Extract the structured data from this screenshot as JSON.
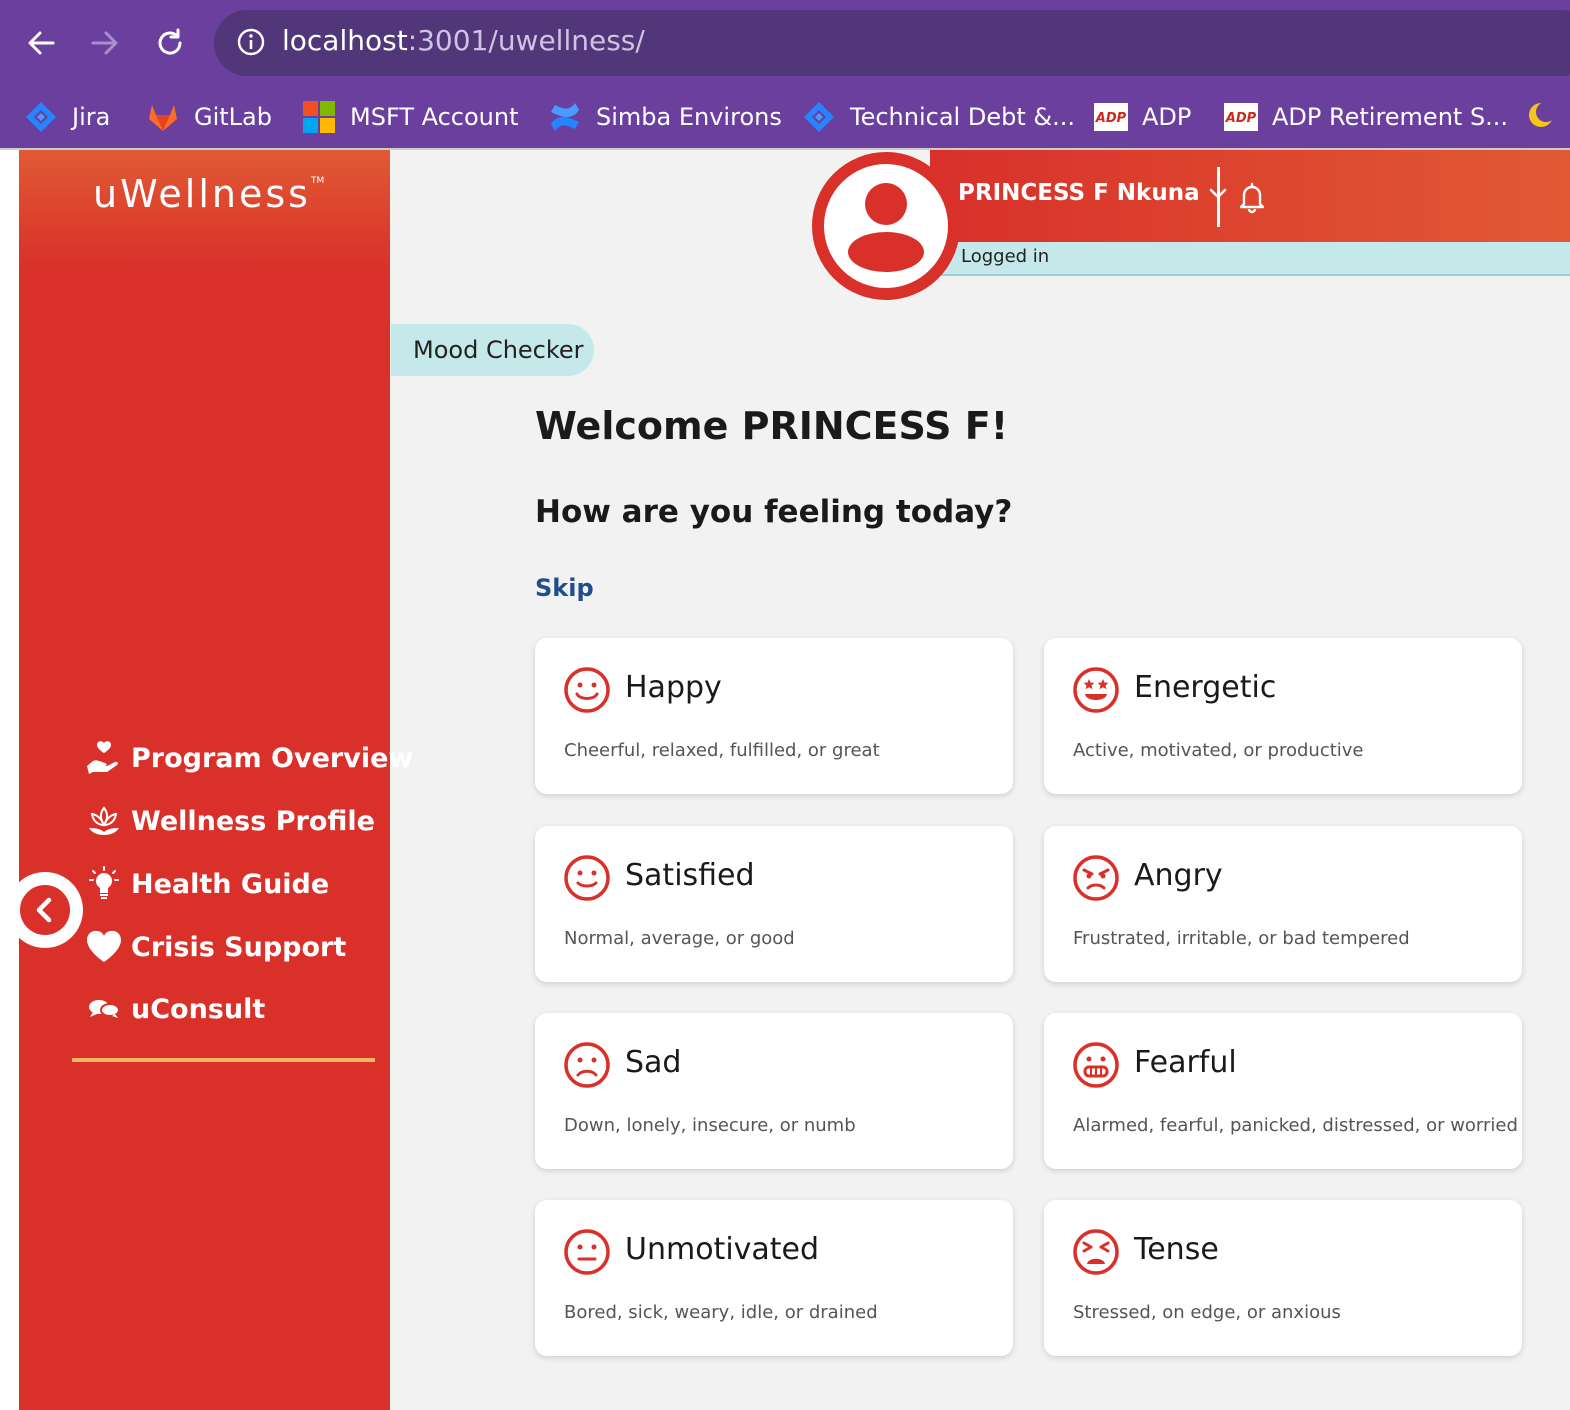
{
  "browser": {
    "url_host": "localhost",
    "url_path": ":3001/uwellness/",
    "bookmarks": [
      {
        "label": "Jira"
      },
      {
        "label": "GitLab"
      },
      {
        "label": "MSFT Account"
      },
      {
        "label": "Simba Environs"
      },
      {
        "label": "Technical Debt &..."
      },
      {
        "label": "ADP"
      },
      {
        "label": "ADP Retirement S..."
      }
    ]
  },
  "sidebar": {
    "logo": "uWellness",
    "logo_tm": "TM",
    "items": [
      {
        "label": "Program Overview",
        "icon": "hand-heart-icon"
      },
      {
        "label": "Wellness Profile",
        "icon": "lotus-icon"
      },
      {
        "label": "Health Guide",
        "icon": "lightbulb-icon"
      },
      {
        "label": "Crisis Support",
        "icon": "heart-icon"
      },
      {
        "label": "uConsult",
        "icon": "chat-bubbles-icon"
      }
    ]
  },
  "header": {
    "user_name": "PRINCESS F Nkuna",
    "status": "Logged in"
  },
  "main": {
    "tab": "Mood Checker",
    "welcome": "Welcome PRINCESS F!",
    "question": "How are you feeling today?",
    "skip": "Skip",
    "moods": [
      {
        "label": "Happy",
        "desc": "Cheerful, relaxed, fulfilled, or great"
      },
      {
        "label": "Energetic",
        "desc": "Active, motivated, or productive"
      },
      {
        "label": "Satisfied",
        "desc": "Normal, average, or good"
      },
      {
        "label": "Angry",
        "desc": "Frustrated, irritable, or bad tempered"
      },
      {
        "label": "Sad",
        "desc": "Down, lonely, insecure, or numb"
      },
      {
        "label": "Fearful",
        "desc": "Alarmed, fearful, panicked, distressed, or worried"
      },
      {
        "label": "Unmotivated",
        "desc": "Bored, sick, weary, idle, or drained"
      },
      {
        "label": "Tense",
        "desc": "Stressed, on edge, or anxious"
      }
    ]
  },
  "colors": {
    "brand_red": "#d9302a",
    "accent_teal": "#c5e8ea",
    "chrome_purple": "#6a3f9e"
  }
}
